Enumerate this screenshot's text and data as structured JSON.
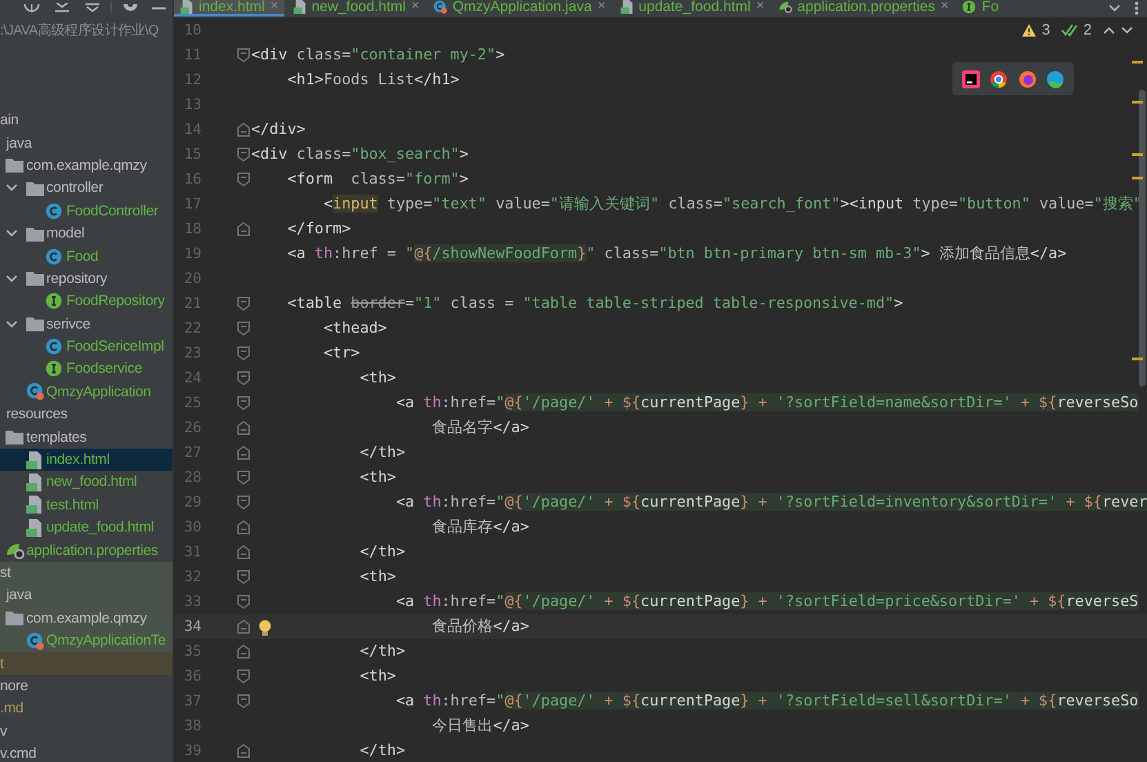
{
  "project": {
    "path": ":\\JAVA高级程序设计作业\\Q",
    "tree": [
      {
        "label": "ain",
        "color": "#bbbbbb",
        "test_source": false,
        "excluded": false,
        "selected": false,
        "children": [
          {
            "label": "java",
            "color": "#bbbbbb",
            "test_source": false,
            "excluded": false,
            "selected": false,
            "children": [
              {
                "label": "com.example.qmzy",
                "kind": "folder",
                "color": "#bbbbbb",
                "test_source": false,
                "excluded": false,
                "selected": false,
                "children": [
                  {
                    "label": "controller",
                    "kind": "folder",
                    "color": "#bbbbbb",
                    "test_source": false,
                    "excluded": false,
                    "selected": false,
                    "expanded": true,
                    "children": [
                      {
                        "label": "FoodController",
                        "kind": "class",
                        "color": "#62b543",
                        "test_source": false,
                        "excluded": false,
                        "selected": false
                      }
                    ]
                  },
                  {
                    "label": "model",
                    "kind": "folder",
                    "color": "#bbbbbb",
                    "test_source": false,
                    "excluded": false,
                    "selected": false,
                    "expanded": true,
                    "children": [
                      {
                        "label": "Food",
                        "kind": "class",
                        "color": "#62b543",
                        "test_source": false,
                        "excluded": false,
                        "selected": false
                      }
                    ]
                  },
                  {
                    "label": "repository",
                    "kind": "folder",
                    "color": "#bbbbbb",
                    "test_source": false,
                    "excluded": false,
                    "selected": false,
                    "expanded": true,
                    "children": [
                      {
                        "label": "FoodRepository",
                        "kind": "interface",
                        "color": "#62b543",
                        "test_source": false,
                        "excluded": false,
                        "selected": false
                      }
                    ]
                  },
                  {
                    "label": "serivce",
                    "kind": "folder",
                    "color": "#bbbbbb",
                    "test_source": false,
                    "excluded": false,
                    "selected": false,
                    "expanded": true,
                    "children": [
                      {
                        "label": "FoodSericeImpl",
                        "kind": "class",
                        "color": "#62b543",
                        "test_source": false,
                        "excluded": false,
                        "selected": false
                      },
                      {
                        "label": "Foodservice",
                        "kind": "interface",
                        "color": "#62b543",
                        "test_source": false,
                        "excluded": false,
                        "selected": false
                      }
                    ]
                  },
                  {
                    "label": "QmzyApplication",
                    "kind": "app",
                    "color": "#62b543",
                    "test_source": false,
                    "excluded": false,
                    "selected": false
                  }
                ]
              }
            ]
          },
          {
            "label": "resources",
            "color": "#bbbbbb",
            "test_source": false,
            "excluded": false,
            "selected": false,
            "children": [
              {
                "label": "templates",
                "kind": "folder",
                "color": "#bbbbbb",
                "test_source": false,
                "excluded": false,
                "selected": false,
                "children": [
                  {
                    "label": "index.html",
                    "kind": "html",
                    "color": "#62b543",
                    "test_source": false,
                    "excluded": false,
                    "selected": true
                  },
                  {
                    "label": "new_food.html",
                    "kind": "html",
                    "color": "#62b543",
                    "test_source": false,
                    "excluded": false,
                    "selected": false
                  },
                  {
                    "label": "test.html",
                    "kind": "html",
                    "color": "#62b543",
                    "test_source": false,
                    "excluded": false,
                    "selected": false
                  },
                  {
                    "label": "update_food.html",
                    "kind": "html",
                    "color": "#62b543",
                    "test_source": false,
                    "excluded": false,
                    "selected": false
                  }
                ]
              },
              {
                "label": "application.properties",
                "kind": "properties",
                "color": "#62b543",
                "test_source": false,
                "excluded": false,
                "selected": false
              }
            ]
          }
        ]
      },
      {
        "label": "st",
        "color": "#bbbbbb",
        "test_source": true,
        "excluded": false,
        "selected": false,
        "children": [
          {
            "label": "java",
            "color": "#bbbbbb",
            "test_source": true,
            "excluded": false,
            "selected": false,
            "children": [
              {
                "label": "com.example.qmzy",
                "kind": "folder",
                "color": "#bbbbbb",
                "test_source": true,
                "excluded": false,
                "selected": false,
                "children": [
                  {
                    "label": "QmzyApplicationTe",
                    "kind": "app",
                    "color": "#62b543",
                    "test_source": true,
                    "excluded": false,
                    "selected": false
                  }
                ]
              }
            ]
          }
        ]
      },
      {
        "label": "t",
        "color": "#a89e58",
        "test_source": false,
        "excluded": true,
        "selected": false
      },
      {
        "label": "nore",
        "color": "#bbbbbb",
        "test_source": false,
        "excluded": false,
        "selected": false
      },
      {
        "label": ".md",
        "color": "#a89e58",
        "test_source": false,
        "excluded": false,
        "selected": false
      },
      {
        "label": "v",
        "color": "#bbbbbb",
        "test_source": false,
        "excluded": false,
        "selected": false
      },
      {
        "label": "v.cmd",
        "color": "#bbbbbb",
        "test_source": false,
        "excluded": false,
        "selected": false
      }
    ]
  },
  "editor": {
    "tabs": [
      {
        "label": "index.html",
        "kind": "html",
        "selected": true,
        "close": "×"
      },
      {
        "label": "new_food.html",
        "kind": "html",
        "selected": false,
        "close": "×"
      },
      {
        "label": "QmzyApplication.java",
        "kind": "app",
        "selected": false,
        "close": "×"
      },
      {
        "label": "update_food.html",
        "kind": "html",
        "selected": false,
        "close": "×"
      },
      {
        "label": "application.properties",
        "kind": "properties",
        "selected": false,
        "close": "×"
      },
      {
        "label": "Fo",
        "kind": "interface",
        "selected": false
      }
    ],
    "inspections": {
      "warnings": "3",
      "passed": "2"
    },
    "lines": [
      {
        "number": "10",
        "current": false,
        "fold_start": false,
        "fold_end": false
      },
      {
        "number": "11",
        "current": false,
        "fold_start": true,
        "fold_end": false,
        "tokens": [
          {
            "kind": "tag",
            "text": "<div"
          },
          {
            "kind": "attr",
            "text": " class="
          },
          {
            "kind": "str",
            "text": "\"container my-2\""
          },
          {
            "kind": "tag",
            "text": ">"
          }
        ]
      },
      {
        "number": "12",
        "current": false,
        "fold_start": false,
        "fold_end": false,
        "tokens": [
          {
            "kind": "tag",
            "text": "    <h1>"
          },
          {
            "kind": "plain",
            "text": "Foods List"
          },
          {
            "kind": "tag",
            "text": "</h1>"
          }
        ]
      },
      {
        "number": "13",
        "current": false,
        "fold_start": false,
        "fold_end": false
      },
      {
        "number": "14",
        "current": false,
        "fold_start": false,
        "fold_end": true,
        "tokens": [
          {
            "kind": "tag",
            "text": "</div>"
          }
        ]
      },
      {
        "number": "15",
        "current": false,
        "fold_start": true,
        "fold_end": false,
        "tokens": [
          {
            "kind": "tag",
            "text": "<div"
          },
          {
            "kind": "attr",
            "text": " class="
          },
          {
            "kind": "str",
            "text": "\"box_search\""
          },
          {
            "kind": "tag",
            "text": ">"
          }
        ]
      },
      {
        "number": "16",
        "current": false,
        "fold_start": true,
        "fold_end": false,
        "tokens": [
          {
            "kind": "tag",
            "text": "    <form"
          },
          {
            "kind": "attr",
            "text": "  class="
          },
          {
            "kind": "str",
            "text": "\"form\""
          },
          {
            "kind": "tag",
            "text": ">"
          }
        ]
      },
      {
        "number": "17",
        "current": false,
        "fold_start": false,
        "fold_end": false,
        "tokens": [
          {
            "kind": "tag",
            "text": "        <"
          },
          {
            "kind": "match",
            "text": "input"
          },
          {
            "kind": "attr",
            "text": " type="
          },
          {
            "kind": "str",
            "text": "\"text\""
          },
          {
            "kind": "attr",
            "text": " value="
          },
          {
            "kind": "str",
            "text": "\"请输入关键词\""
          },
          {
            "kind": "attr",
            "text": " class="
          },
          {
            "kind": "str",
            "text": "\"search_font\""
          },
          {
            "kind": "tag",
            "text": "><input"
          },
          {
            "kind": "attr",
            "text": " type="
          },
          {
            "kind": "str",
            "text": "\"button\""
          },
          {
            "kind": "attr",
            "text": " value="
          },
          {
            "kind": "str",
            "text": "\"搜索\""
          }
        ]
      },
      {
        "number": "18",
        "current": false,
        "fold_start": false,
        "fold_end": true,
        "tokens": [
          {
            "kind": "tag",
            "text": "    </form>"
          }
        ]
      },
      {
        "number": "19",
        "current": false,
        "fold_start": false,
        "fold_end": false,
        "tokens": [
          {
            "kind": "tag",
            "text": "    <a"
          },
          {
            "kind": "ns",
            "text": " th"
          },
          {
            "kind": "attr",
            "text": ":href = "
          },
          {
            "kind": "str",
            "text": "\""
          },
          {
            "kind": "x-op",
            "text": "@{"
          },
          {
            "kind": "x-str",
            "text": "/showNewFoodForm"
          },
          {
            "kind": "x-op",
            "text": "}"
          },
          {
            "kind": "str",
            "text": "\""
          },
          {
            "kind": "attr",
            "text": " class="
          },
          {
            "kind": "str",
            "text": "\"btn btn-primary btn-sm mb-3\""
          },
          {
            "kind": "tag",
            "text": ">"
          },
          {
            "kind": "plain",
            "text": " 添加食品信息"
          },
          {
            "kind": "tag",
            "text": "</a>"
          }
        ]
      },
      {
        "number": "20",
        "current": false,
        "fold_start": false,
        "fold_end": false
      },
      {
        "number": "21",
        "current": false,
        "fold_start": true,
        "fold_end": false,
        "tokens": [
          {
            "kind": "tag",
            "text": "    <table "
          },
          {
            "kind": "strike",
            "text": "border"
          },
          {
            "kind": "attr",
            "text": "="
          },
          {
            "kind": "str",
            "text": "\"1\""
          },
          {
            "kind": "attr",
            "text": " class = "
          },
          {
            "kind": "str",
            "text": "\"table table-striped table-responsive-md\""
          },
          {
            "kind": "tag",
            "text": ">"
          }
        ]
      },
      {
        "number": "22",
        "current": false,
        "fold_start": true,
        "fold_end": false,
        "tokens": [
          {
            "kind": "tag",
            "text": "        <thead>"
          }
        ]
      },
      {
        "number": "23",
        "current": false,
        "fold_start": true,
        "fold_end": false,
        "tokens": [
          {
            "kind": "tag",
            "text": "        <tr>"
          }
        ]
      },
      {
        "number": "24",
        "current": false,
        "fold_start": true,
        "fold_end": false,
        "tokens": [
          {
            "kind": "tag",
            "text": "            <th>"
          }
        ]
      },
      {
        "number": "25",
        "current": false,
        "fold_start": true,
        "fold_end": false,
        "tokens": [
          {
            "kind": "tag",
            "text": "                <a"
          },
          {
            "kind": "ns",
            "text": " th"
          },
          {
            "kind": "attr",
            "text": ":href="
          },
          {
            "kind": "str",
            "text": "\""
          },
          {
            "kind": "x-op",
            "text": "@{"
          },
          {
            "kind": "x-str",
            "text": "'/page/'"
          },
          {
            "kind": "x-op",
            "text": " + ${"
          },
          {
            "kind": "x-var",
            "text": "currentPage"
          },
          {
            "kind": "x-op",
            "text": "} + "
          },
          {
            "kind": "x-str",
            "text": "'?sortField=name&sortDir='"
          },
          {
            "kind": "x-op",
            "text": " + ${"
          },
          {
            "kind": "x-var",
            "text": "reverseSo"
          }
        ]
      },
      {
        "number": "26",
        "current": false,
        "fold_start": false,
        "fold_end": true,
        "tokens": [
          {
            "kind": "plain",
            "text": "                    食品名字"
          },
          {
            "kind": "tag",
            "text": "</a>"
          }
        ]
      },
      {
        "number": "27",
        "current": false,
        "fold_start": false,
        "fold_end": true,
        "tokens": [
          {
            "kind": "tag",
            "text": "            </th>"
          }
        ]
      },
      {
        "number": "28",
        "current": false,
        "fold_start": true,
        "fold_end": false,
        "tokens": [
          {
            "kind": "tag",
            "text": "            <th>"
          }
        ]
      },
      {
        "number": "29",
        "current": false,
        "fold_start": true,
        "fold_end": false,
        "tokens": [
          {
            "kind": "tag",
            "text": "                <a"
          },
          {
            "kind": "ns",
            "text": " th"
          },
          {
            "kind": "attr",
            "text": ":href="
          },
          {
            "kind": "str",
            "text": "\""
          },
          {
            "kind": "x-op",
            "text": "@{"
          },
          {
            "kind": "x-str",
            "text": "'/page/'"
          },
          {
            "kind": "x-op",
            "text": " + ${"
          },
          {
            "kind": "x-var",
            "text": "currentPage"
          },
          {
            "kind": "x-op",
            "text": "} + "
          },
          {
            "kind": "x-str",
            "text": "'?sortField=inventory&sortDir='"
          },
          {
            "kind": "x-op",
            "text": " + ${"
          },
          {
            "kind": "x-var",
            "text": "rever"
          }
        ]
      },
      {
        "number": "30",
        "current": false,
        "fold_start": false,
        "fold_end": true,
        "tokens": [
          {
            "kind": "plain",
            "text": "                    食品库存"
          },
          {
            "kind": "tag",
            "text": "</a>"
          }
        ]
      },
      {
        "number": "31",
        "current": false,
        "fold_start": false,
        "fold_end": true,
        "tokens": [
          {
            "kind": "tag",
            "text": "            </th>"
          }
        ]
      },
      {
        "number": "32",
        "current": false,
        "fold_start": true,
        "fold_end": false,
        "tokens": [
          {
            "kind": "tag",
            "text": "            <th>"
          }
        ]
      },
      {
        "number": "33",
        "current": false,
        "fold_start": true,
        "fold_end": false,
        "tokens": [
          {
            "kind": "tag",
            "text": "                <a"
          },
          {
            "kind": "ns",
            "text": " th"
          },
          {
            "kind": "attr",
            "text": ":href="
          },
          {
            "kind": "str",
            "text": "\""
          },
          {
            "kind": "x-op",
            "text": "@{"
          },
          {
            "kind": "x-str",
            "text": "'/page/'"
          },
          {
            "kind": "x-op",
            "text": " + ${"
          },
          {
            "kind": "x-var",
            "text": "currentPage"
          },
          {
            "kind": "x-op",
            "text": "} + "
          },
          {
            "kind": "x-str",
            "text": "'?sortField=price&sortDir='"
          },
          {
            "kind": "x-op",
            "text": " + ${"
          },
          {
            "kind": "x-var",
            "text": "reverseS"
          }
        ]
      },
      {
        "number": "34",
        "current": true,
        "fold_start": false,
        "fold_end": true,
        "tokens": [
          {
            "kind": "plain",
            "text": "                    食品价格"
          },
          {
            "kind": "tag",
            "text": "</a>"
          }
        ]
      },
      {
        "number": "35",
        "current": false,
        "fold_start": false,
        "fold_end": true,
        "tokens": [
          {
            "kind": "tag",
            "text": "            </th>"
          }
        ]
      },
      {
        "number": "36",
        "current": false,
        "fold_start": true,
        "fold_end": false,
        "tokens": [
          {
            "kind": "tag",
            "text": "            <th>"
          }
        ]
      },
      {
        "number": "37",
        "current": false,
        "fold_start": true,
        "fold_end": false,
        "tokens": [
          {
            "kind": "tag",
            "text": "                <a"
          },
          {
            "kind": "ns",
            "text": " th"
          },
          {
            "kind": "attr",
            "text": ":href="
          },
          {
            "kind": "str",
            "text": "\""
          },
          {
            "kind": "x-op",
            "text": "@{"
          },
          {
            "kind": "x-str",
            "text": "'/page/'"
          },
          {
            "kind": "x-op",
            "text": " + ${"
          },
          {
            "kind": "x-var",
            "text": "currentPage"
          },
          {
            "kind": "x-op",
            "text": "} + "
          },
          {
            "kind": "x-str",
            "text": "'?sortField=sell&sortDir='"
          },
          {
            "kind": "x-op",
            "text": " + ${"
          },
          {
            "kind": "x-var",
            "text": "reverseSo"
          }
        ]
      },
      {
        "number": "38",
        "current": false,
        "fold_start": false,
        "fold_end": false,
        "tokens": [
          {
            "kind": "plain",
            "text": "                    今日售出"
          },
          {
            "kind": "tag",
            "text": "</a>"
          }
        ]
      },
      {
        "number": "39",
        "current": false,
        "fold_start": false,
        "fold_end": true,
        "tokens": [
          {
            "kind": "tag",
            "text": "            </th>"
          }
        ]
      }
    ]
  }
}
